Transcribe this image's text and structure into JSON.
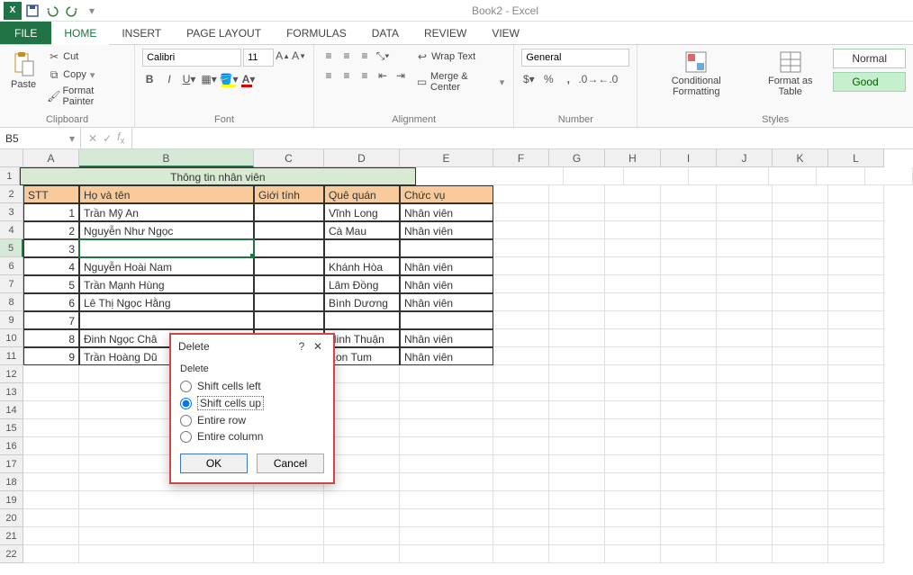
{
  "app": {
    "title": "Book2 - Excel"
  },
  "tabs": {
    "file": "FILE",
    "home": "HOME",
    "insert": "INSERT",
    "page_layout": "PAGE LAYOUT",
    "formulas": "FORMULAS",
    "data": "DATA",
    "review": "REVIEW",
    "view": "VIEW"
  },
  "ribbon": {
    "clipboard": {
      "paste": "Paste",
      "cut": "Cut",
      "copy": "Copy",
      "format_painter": "Format Painter",
      "label": "Clipboard"
    },
    "font": {
      "name": "Calibri",
      "size": "11",
      "label": "Font"
    },
    "alignment": {
      "wrap": "Wrap Text",
      "merge": "Merge & Center",
      "label": "Alignment"
    },
    "number": {
      "format": "General",
      "label": "Number"
    },
    "styles": {
      "cond": "Conditional Formatting",
      "table": "Format as Table",
      "normal": "Normal",
      "good": "Good",
      "label": "Styles"
    }
  },
  "namebox": "B5",
  "columns": [
    "A",
    "B",
    "C",
    "D",
    "E",
    "F",
    "G",
    "H",
    "I",
    "J",
    "K",
    "L"
  ],
  "sheet": {
    "title": "Thông tin nhân viên",
    "headers": {
      "stt": "STT",
      "name": "Họ và tên",
      "gender": "Giới tính",
      "origin": "Quê quán",
      "role": "Chức vụ"
    },
    "rows": [
      {
        "n": "1",
        "name": "Trần Mỹ An",
        "origin": "Vĩnh Long",
        "role": "Nhân viên"
      },
      {
        "n": "2",
        "name": "Nguyễn Như Ngọc",
        "origin": "Cà Mau",
        "role": "Nhân viên"
      },
      {
        "n": "3",
        "name": "",
        "origin": "",
        "role": ""
      },
      {
        "n": "4",
        "name": "Nguyễn Hoài Nam",
        "origin": "Khánh Hòa",
        "role": "Nhân viên"
      },
      {
        "n": "5",
        "name": "Trần Mạnh Hùng",
        "origin": "Lâm Đồng",
        "role": "Nhân viên"
      },
      {
        "n": "6",
        "name": "Lê Thị Ngọc Hằng",
        "origin": "Bình Dương",
        "role": "Nhân viên"
      },
      {
        "n": "7",
        "name": "",
        "origin": "",
        "role": ""
      },
      {
        "n": "8",
        "name": "Đinh Ngọc Châ",
        "origin": "Ninh Thuận",
        "role": "Nhân viên"
      },
      {
        "n": "9",
        "name": "Trần Hoàng Dũ",
        "origin": "Kon Tum",
        "role": "Nhân viên"
      }
    ]
  },
  "dialog": {
    "title": "Delete",
    "section": "Delete",
    "opt_left": "Shift cells left",
    "opt_up": "Shift cells up",
    "opt_row": "Entire row",
    "opt_col": "Entire column",
    "ok": "OK",
    "cancel": "Cancel"
  }
}
